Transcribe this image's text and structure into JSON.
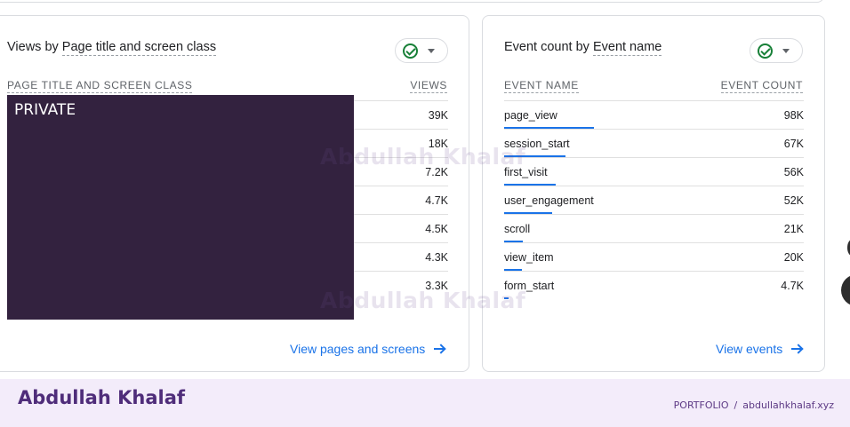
{
  "left_card": {
    "title_prefix": "Views by ",
    "title_dim": "Page title and screen class",
    "col_name": "PAGE TITLE AND SCREEN CLASS",
    "col_value": "VIEWS",
    "private_label": "PRIVATE",
    "rows": [
      {
        "value": "39K"
      },
      {
        "value": "18K"
      },
      {
        "value": "7.2K"
      },
      {
        "value": "4.7K"
      },
      {
        "value": "4.5K"
      },
      {
        "value": "4.3K"
      },
      {
        "value": "3.3K"
      }
    ],
    "footer_link": "View pages and screens"
  },
  "right_card": {
    "title_prefix": "Event count by ",
    "title_dim": "Event name",
    "col_name": "EVENT NAME",
    "col_value": "EVENT COUNT",
    "rows": [
      {
        "name": "page_view",
        "value": "98K",
        "bar_fraction": 1.0
      },
      {
        "name": "session_start",
        "value": "67K",
        "bar_fraction": 0.68
      },
      {
        "name": "first_visit",
        "value": "56K",
        "bar_fraction": 0.57
      },
      {
        "name": "user_engagement",
        "value": "52K",
        "bar_fraction": 0.53
      },
      {
        "name": "scroll",
        "value": "21K",
        "bar_fraction": 0.21
      },
      {
        "name": "view_item",
        "value": "20K",
        "bar_fraction": 0.2
      },
      {
        "name": "form_start",
        "value": "4.7K",
        "bar_fraction": 0.05
      }
    ],
    "footer_link": "View events"
  },
  "watermark": "Abdullah Khalaf",
  "footer": {
    "brand": "Abdullah Khalaf",
    "crumb_section": "PORTFOLIO",
    "crumb_separator": "/",
    "crumb_site": "abdullahkhalaf.xyz"
  },
  "colors": {
    "accent": "#1a73e8",
    "status_ok": "#188038",
    "private_block": "#33223f",
    "brand": "#4f2d7a",
    "footer_bg": "#f3ecfa"
  }
}
